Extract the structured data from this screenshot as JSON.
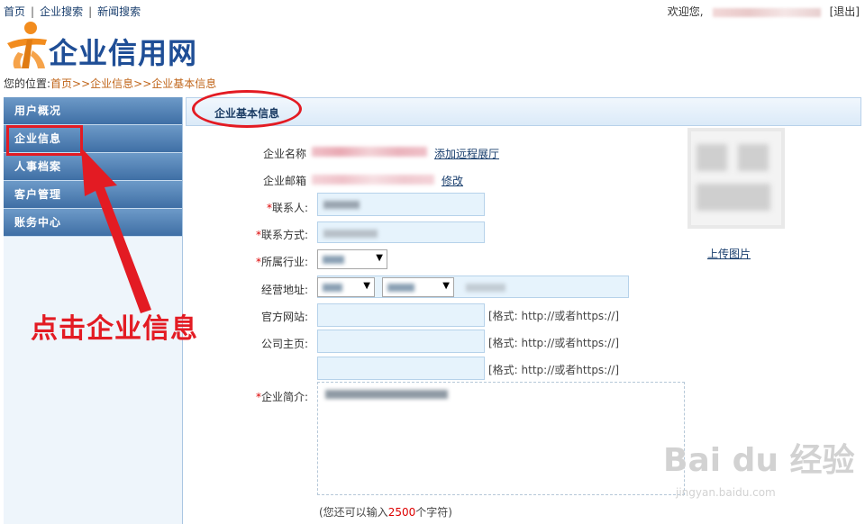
{
  "topbar": {
    "nav": [
      "首页",
      "企业搜索",
      "新闻搜索"
    ],
    "welcome": "欢迎您,",
    "logout": "[退出]"
  },
  "logo": {
    "text": "企业信用网"
  },
  "location": {
    "prefix": "您的位置:",
    "crumbs": "首页>>企业信息>>企业基本信息"
  },
  "sidebar": {
    "items": [
      {
        "label": "用户概况"
      },
      {
        "label": "企业信息"
      },
      {
        "label": "人事档案"
      },
      {
        "label": "客户管理"
      },
      {
        "label": "账务中心"
      }
    ]
  },
  "content": {
    "title": "企业基本信息",
    "company_name_label": "企业名称",
    "add_showroom": "添加远程展厅",
    "email_label": "企业邮箱",
    "modify": "修改",
    "contact_label": "联系人:",
    "phone_label": "联系方式:",
    "industry_label": "所属行业:",
    "address_label": "经营地址:",
    "website_label": "官方网站:",
    "homepage_label": "公司主页:",
    "url_hint": "[格式: http://或者https://]",
    "intro_label": "企业简介:",
    "char_hint_prefix": "(您还可以输入",
    "char_count": "2500",
    "char_hint_suffix": "个字符)",
    "upload_label": "上传图片",
    "required_mark": "*"
  },
  "annotation": {
    "text": "点击企业信息"
  },
  "watermark": {
    "line1": "Bai du 经验",
    "line2": "jingyan.baidu.com"
  },
  "colors": {
    "accent_red": "#e31b23",
    "sidebar_blue": "#4a7ab0",
    "link_blue": "#1a3f6e"
  }
}
